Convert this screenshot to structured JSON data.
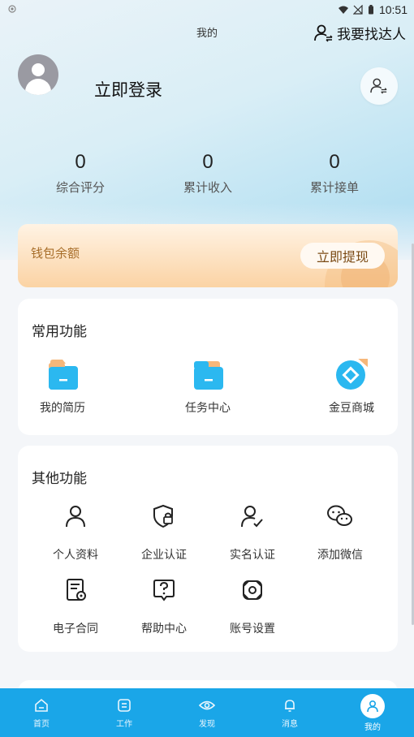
{
  "status_bar": {
    "time": "10:51"
  },
  "header": {
    "title": "我的",
    "find_talent": "我要找达人",
    "login": "立即登录"
  },
  "stats": [
    {
      "value": "0",
      "label": "综合评分"
    },
    {
      "value": "0",
      "label": "累计收入"
    },
    {
      "value": "0",
      "label": "累计接单"
    }
  ],
  "wallet": {
    "label": "钱包余额",
    "withdraw": "立即提现"
  },
  "common": {
    "title": "常用功能",
    "items": [
      {
        "label": "我的简历",
        "icon": "resume-folder-icon"
      },
      {
        "label": "任务中心",
        "icon": "task-folder-icon"
      },
      {
        "label": "金豆商城",
        "icon": "bean-mall-icon"
      }
    ]
  },
  "other": {
    "title": "其他功能",
    "items": [
      {
        "label": "个人资料",
        "icon": "user-icon"
      },
      {
        "label": "企业认证",
        "icon": "shield-lock-icon"
      },
      {
        "label": "实名认证",
        "icon": "user-check-icon"
      },
      {
        "label": "添加微信",
        "icon": "wechat-icon"
      },
      {
        "label": "电子合同",
        "icon": "contract-icon"
      },
      {
        "label": "帮助中心",
        "icon": "help-icon"
      },
      {
        "label": "账号设置",
        "icon": "settings-icon"
      }
    ]
  },
  "tabbar": {
    "tabs": [
      {
        "label": "首页",
        "icon": "home-icon"
      },
      {
        "label": "工作",
        "icon": "work-icon"
      },
      {
        "label": "发现",
        "icon": "eye-icon"
      },
      {
        "label": "消息",
        "icon": "bell-icon"
      },
      {
        "label": "我的",
        "icon": "profile-icon"
      }
    ],
    "active": "我的"
  },
  "colors": {
    "tabbar": "#1aa6e8",
    "folder_blue": "#2bb8f0",
    "folder_orange": "#f6b77a",
    "wallet_text": "#a86e2a"
  }
}
